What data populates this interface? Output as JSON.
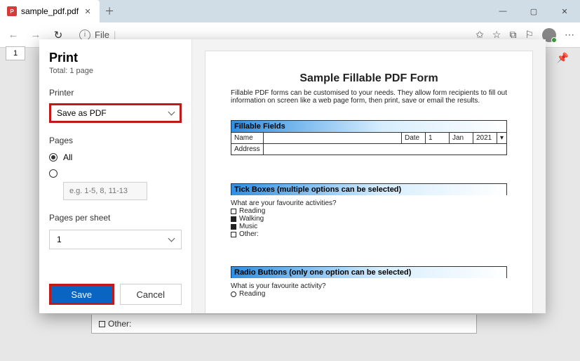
{
  "window": {
    "tab_title": "sample_pdf.pdf",
    "address": "File",
    "page_indicator": "1"
  },
  "bg_doc": {
    "other_label": "Other:"
  },
  "dialog": {
    "title": "Print",
    "total": "Total: 1 page",
    "printer_label": "Printer",
    "printer_value": "Save as PDF",
    "pages_label": "Pages",
    "pages_all": "All",
    "pages_range_placeholder": "e.g. 1-5, 8, 11-13",
    "pps_label": "Pages per sheet",
    "pps_value": "1",
    "save_label": "Save",
    "cancel_label": "Cancel"
  },
  "preview": {
    "title": "Sample Fillable PDF Form",
    "description": "Fillable PDF forms can be customised to your needs. They allow form recipients to fill out information on screen like a web page form, then print, save or email the results.",
    "fillable_header": "Fillable Fields",
    "name_label": "Name",
    "address_label": "Address",
    "date_label": "Date",
    "date_day": "1",
    "date_month": "Jan",
    "date_year": "2021",
    "tick_header": "Tick Boxes (multiple options can be selected)",
    "tick_question": "What are your favourite activities?",
    "tick_opts": [
      "Reading",
      "Walking",
      "Music",
      "Other:"
    ],
    "radio_header": "Radio Buttons (only one option can be selected)",
    "radio_question": "What is your favourite activity?",
    "radio_opt": "Reading"
  }
}
